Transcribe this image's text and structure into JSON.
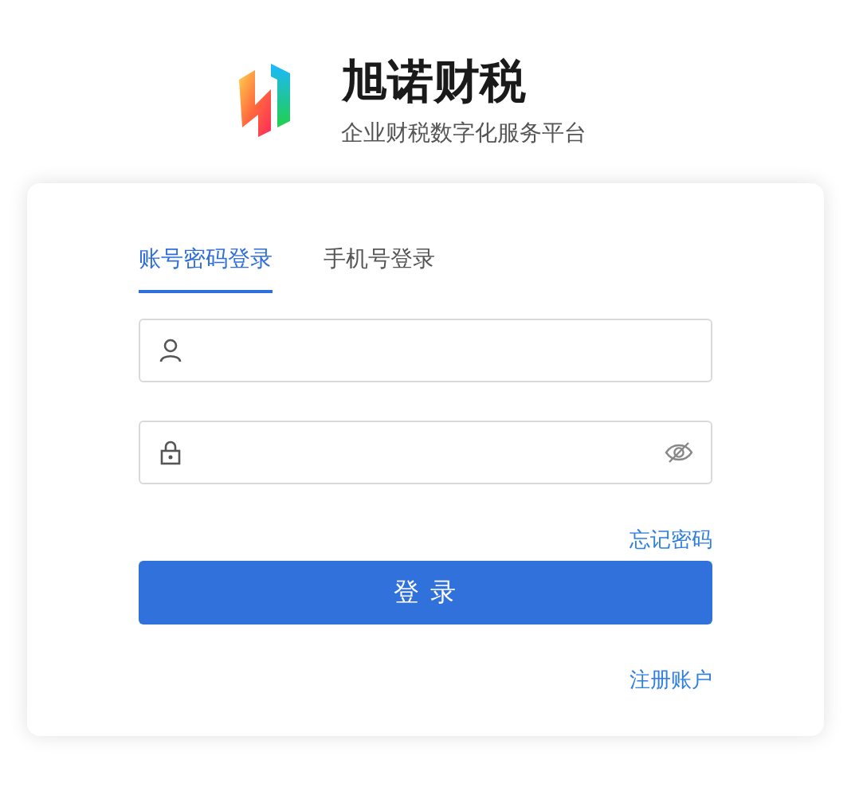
{
  "brand": {
    "name": "旭诺财税",
    "tagline": "企业财税数字化服务平台"
  },
  "tabs": [
    {
      "label": "账号密码登录",
      "selected": true
    },
    {
      "label": "手机号登录",
      "selected": false
    }
  ],
  "forgot_password": "忘记密码",
  "login_button": "登 录",
  "register_link": "注册账户"
}
